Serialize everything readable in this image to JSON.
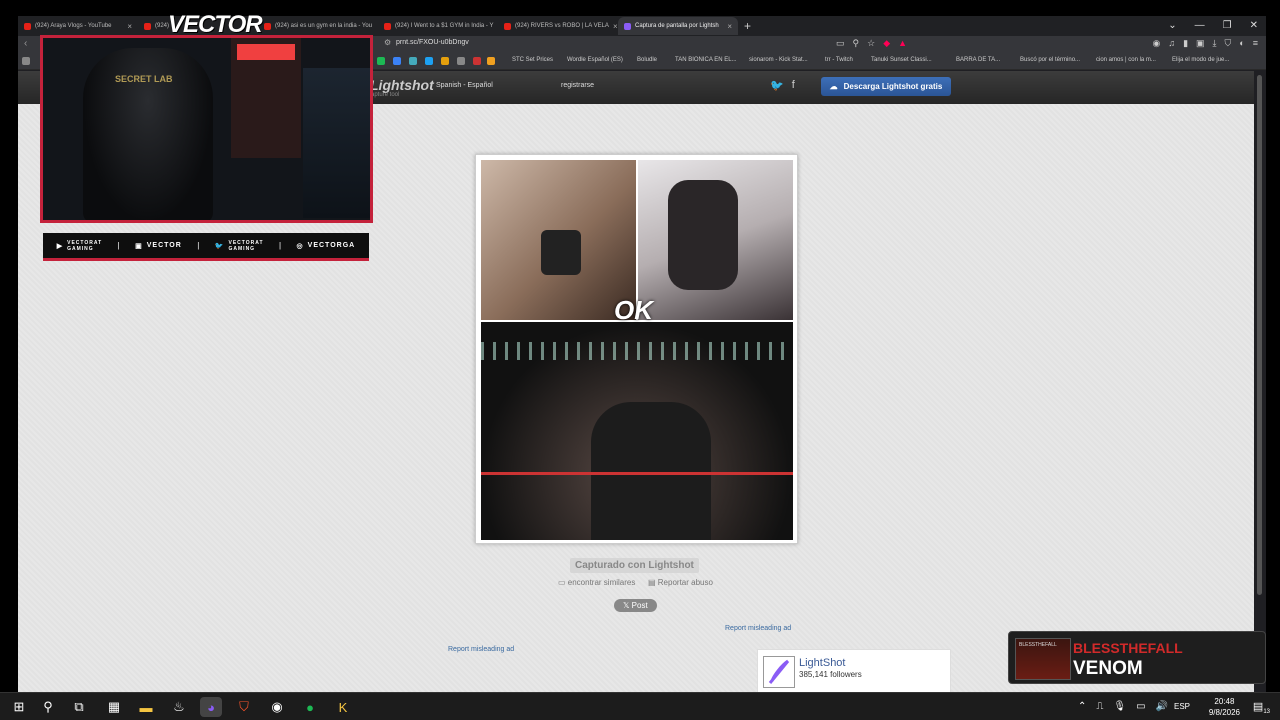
{
  "overlay": {
    "streamer": "VECTOR",
    "chair_brand": "SECRET LAB",
    "socials": [
      {
        "icon": "youtube-icon",
        "top": "VECTORAT",
        "bottom": "GAMING"
      },
      {
        "icon": "twitch-icon",
        "text": "VECTOR"
      },
      {
        "icon": "twitter-icon",
        "top": "VECTORAT",
        "bottom": "GAMING"
      },
      {
        "icon": "instagram-icon",
        "text": "VECTORGA"
      }
    ],
    "now_playing": {
      "artist": "BLESSTHEFALL",
      "song": "VENOM",
      "art_label": "BLESSTHEFALL"
    }
  },
  "tabs": [
    {
      "label": "(924) Araya Vlogs - YouTube"
    },
    {
      "label": "(924)"
    },
    {
      "label": "(924) asi es un gym en la india - You"
    },
    {
      "label": "(924) I Went to a $1 GYM in India - Y"
    },
    {
      "label": "(924) RIVERS vs ROBO | LA VELA"
    },
    {
      "label": "Captura de pantalla por Lightsh"
    }
  ],
  "address": {
    "url": "prnt.sc/FXOU-u0bDngv"
  },
  "bookmarks": [
    "STC Set Prices",
    "Wordle Español (ES)",
    "Boludle",
    "TAN BIONICA EN EL...",
    "sionarom - Kick Stat...",
    "trr - Twitch",
    "Tanuki Sunset Classi...",
    "BARRA DE TA...",
    "Buscó por el término...",
    "cion amos | con la m...",
    "Elija el modo de jue..."
  ],
  "lightshot": {
    "logo": "Lightshot",
    "logo_sub": "capture tool",
    "language": "Spanish - Español",
    "register": "registrarse",
    "download": "Descarga Lightshot gratis",
    "captured": "Capturado con Lightshot",
    "similar": "encontrar similares",
    "report": "Reportar abuso",
    "post": "Post",
    "misleading1": "Report misleading ad",
    "misleading2": "Report misleading ad",
    "fb_name": "LightShot",
    "fb_followers": "385,141 followers",
    "watermark": "OK"
  },
  "taskbar": {
    "time": "20:48",
    "date": "9/8/2026",
    "lang": "ESP",
    "notif_count": "13"
  }
}
